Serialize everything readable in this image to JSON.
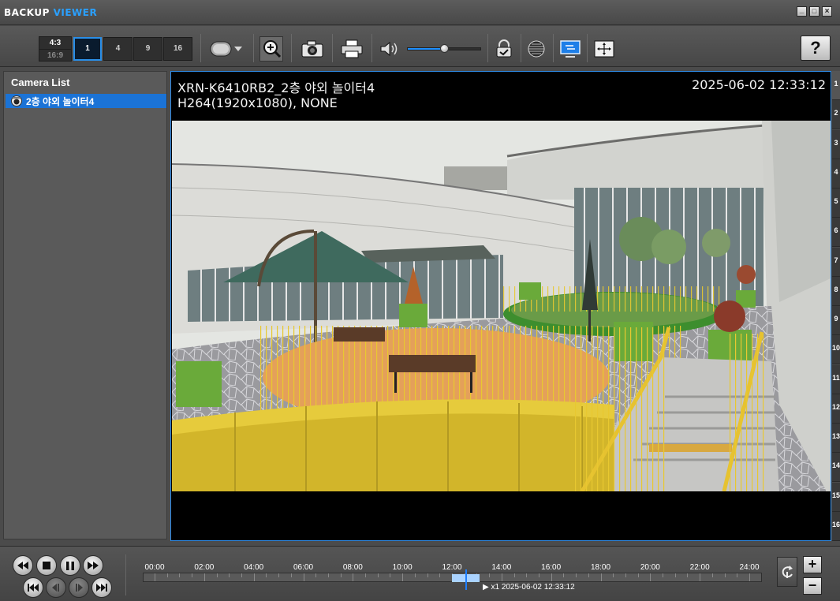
{
  "app": {
    "title_main": "BACKUP",
    "title_accent": "VIEWER",
    "window_buttons": {
      "minimize": "_",
      "restore": "□",
      "close": "×"
    }
  },
  "toolbar": {
    "ratio_a": "4:3",
    "ratio_b": "16:9",
    "splits": [
      "1",
      "4",
      "9",
      "16"
    ],
    "active_split": "1",
    "volume_percent": 51,
    "help_label": "?",
    "icons": [
      "record-icon",
      "dropdown-arrow-icon",
      "zoom-icon",
      "snapshot-icon",
      "print-icon",
      "speaker-icon",
      "verify-icon",
      "sphere-icon",
      "monitor-icon",
      "fullscreen-icon"
    ]
  },
  "camera_list": {
    "title": "Camera List",
    "items": [
      {
        "label": "2층 야외 놀이터4",
        "selected": true
      }
    ]
  },
  "video": {
    "camera_name": "XRN-K6410RB2_2층 야외 놀이터4",
    "codec_info": "H264(1920x1080), NONE",
    "timestamp": "2025-06-02 12:33:12"
  },
  "channels": [
    "1",
    "2",
    "3",
    "4",
    "5",
    "6",
    "7",
    "8",
    "9",
    "10",
    "11",
    "12",
    "13",
    "14",
    "15",
    "16"
  ],
  "playback": {
    "row1": [
      "rewind-icon",
      "stop-icon",
      "pause-icon",
      "fast-forward-icon"
    ],
    "row2": [
      "skip-start-icon",
      "step-back-icon",
      "step-forward-icon",
      "skip-end-icon"
    ],
    "timeline_labels": [
      "00:00",
      "02:00",
      "04:00",
      "06:00",
      "08:00",
      "10:00",
      "12:00",
      "14:00",
      "16:00",
      "18:00",
      "20:00",
      "22:00",
      "24:00"
    ],
    "recorded_segment": {
      "start_hour": 12.0,
      "end_hour": 13.1
    },
    "current_hour": 12.55,
    "speed_label": "x1",
    "status_time": "2025-06-02 12:33:12",
    "zoom_in_label": "+",
    "zoom_out_label": "−"
  }
}
